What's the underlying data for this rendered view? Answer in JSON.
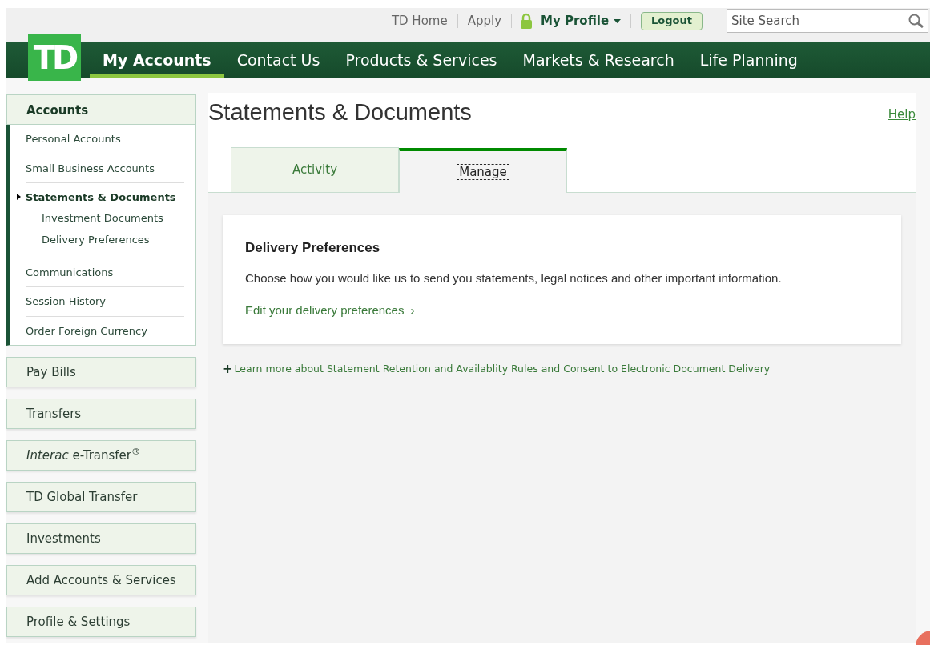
{
  "top_bar": {
    "links": [
      {
        "label": "TD Home"
      },
      {
        "label": "Apply"
      }
    ],
    "profile": "My Profile",
    "logout": "Logout",
    "search": {
      "placeholder": "Site Search"
    }
  },
  "logo": "TD",
  "nav": [
    {
      "label": "My Accounts",
      "selected": true
    },
    {
      "label": "Contact Us",
      "selected": false
    },
    {
      "label": "Products & Services",
      "selected": false
    },
    {
      "label": "Markets & Research",
      "selected": false
    },
    {
      "label": "Life Planning",
      "selected": false
    }
  ],
  "sidebar": [
    {
      "label": "Accounts",
      "expanded": true,
      "items": [
        {
          "label": "Personal Accounts",
          "selected": false
        },
        {
          "label": "Small Business Accounts",
          "selected": false
        },
        {
          "label": "Statements & Documents",
          "selected": true,
          "children": [
            {
              "label": "Investment Documents"
            },
            {
              "label": "Delivery Preferences"
            }
          ]
        },
        {
          "label": "Communications",
          "selected": false
        },
        {
          "label": "Session History",
          "selected": false
        },
        {
          "label": "Order Foreign Currency",
          "selected": false
        }
      ]
    },
    {
      "label": "Pay Bills",
      "expanded": false
    },
    {
      "label": "Transfers",
      "expanded": false
    },
    {
      "label": "*Interac* e-Transfer$^{®}$",
      "expanded": false
    },
    {
      "label": "TD Global Transfer",
      "expanded": false
    },
    {
      "label": "Investments",
      "expanded": false
    },
    {
      "label": "Add Accounts & Services",
      "expanded": false
    },
    {
      "label": "Profile & Settings",
      "expanded": false
    }
  ],
  "page_title": "Statements & Documents",
  "help": "Help",
  "tabs": [
    {
      "label": "Activity",
      "selected": false
    },
    {
      "label": "Manage",
      "selected": true
    }
  ],
  "card": {
    "title": "Delivery Preferences",
    "text": "Choose how you would like us to send you statements, legal notices and other important information.",
    "link": "Edit your delivery preferences",
    "link_arrow": "›"
  },
  "expand_link": {
    "icon": "+",
    "label": "Learn more about Statement Retention and Availablity Rules and Consent to Electronic Document Delivery"
  }
}
